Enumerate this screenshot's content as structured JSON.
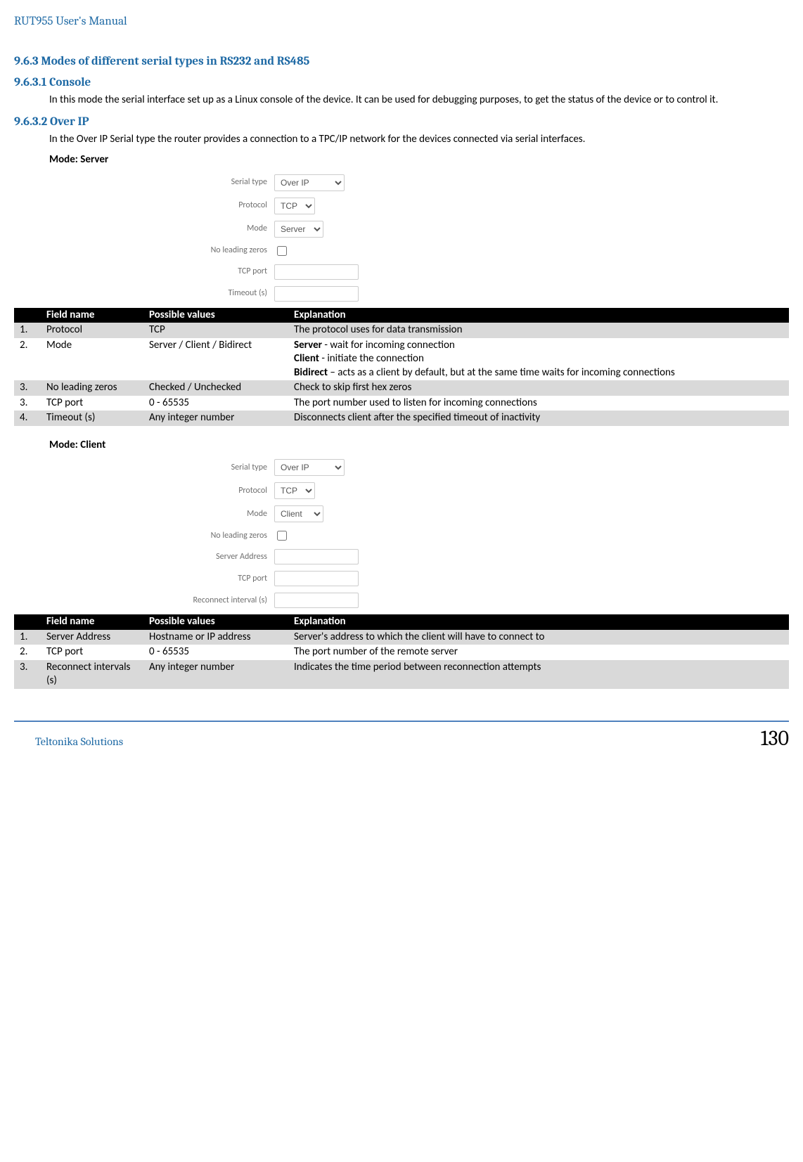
{
  "header": {
    "doc_title": "RUT955 User's Manual"
  },
  "section963": {
    "heading": "9.6.3 Modes of different serial types in RS232 and RS485",
    "console": {
      "heading": "9.6.3.1   Console",
      "body": "In this mode the serial interface set up as a Linux console of the device. It can be used for debugging purposes, to get the status of the device or to control it."
    },
    "overip": {
      "heading": "9.6.3.2   Over IP",
      "body": "In the Over IP Serial type the router provides a connection to a TPC/IP network for the devices connected via serial interfaces."
    }
  },
  "serverMode": {
    "label": "Mode: Server",
    "form": {
      "serial_type_label": "Serial type",
      "serial_type_value": "Over IP",
      "protocol_label": "Protocol",
      "protocol_value": "TCP",
      "mode_label": "Mode",
      "mode_value": "Server",
      "no_leading_label": "No leading zeros",
      "tcpport_label": "TCP port",
      "timeout_label": "Timeout (s)"
    },
    "table": {
      "headers": {
        "field": "Field name",
        "possible": "Possible values",
        "expl": "Explanation"
      },
      "rows": [
        {
          "num": "1.",
          "field": "Protocol",
          "poss": "TCP",
          "expl_html": "The protocol uses for data transmission"
        },
        {
          "num": "2.",
          "field": "Mode",
          "poss": "Server / Client / Bidirect",
          "expl_html": "<b>Server</b> - wait for incoming connection<br><b>Client</b> - initiate the connection<br><b>Bidirect</b> – acts as a client by default, but at the same time waits for incoming connections"
        },
        {
          "num": "3.",
          "field": "No leading zeros",
          "poss": "Checked / Unchecked",
          "expl_html": "Check to skip first hex zeros"
        },
        {
          "num": "3.",
          "field": "TCP port",
          "poss": "0 - 65535",
          "expl_html": "The port number used to listen for incoming connections"
        },
        {
          "num": "4.",
          "field": "Timeout (s)",
          "poss": "Any integer number",
          "expl_html": "Disconnects client after the specified timeout of inactivity"
        }
      ]
    }
  },
  "clientMode": {
    "label": "Mode: Client",
    "form": {
      "serial_type_label": "Serial type",
      "serial_type_value": "Over IP",
      "protocol_label": "Protocol",
      "protocol_value": "TCP",
      "mode_label": "Mode",
      "mode_value": "Client",
      "no_leading_label": "No leading zeros",
      "server_addr_label": "Server Address",
      "tcpport_label": "TCP port",
      "reconnect_label": "Reconnect interval (s)"
    },
    "table": {
      "headers": {
        "field": "Field name",
        "possible": "Possible values",
        "expl": "Explanation"
      },
      "rows": [
        {
          "num": "1.",
          "field": "Server Address",
          "poss": "Hostname or IP address",
          "expl_html": "Server's address to which the client will have to connect to"
        },
        {
          "num": "2.",
          "field": "TCP port",
          "poss": "0 - 65535",
          "expl_html": "The port number of the remote server"
        },
        {
          "num": "3.",
          "field": "Reconnect intervals (s)",
          "poss": "Any integer number",
          "expl_html": "Indicates the time period between reconnection attempts"
        }
      ]
    }
  },
  "footer": {
    "company": "Teltonika Solutions",
    "page": "130"
  }
}
